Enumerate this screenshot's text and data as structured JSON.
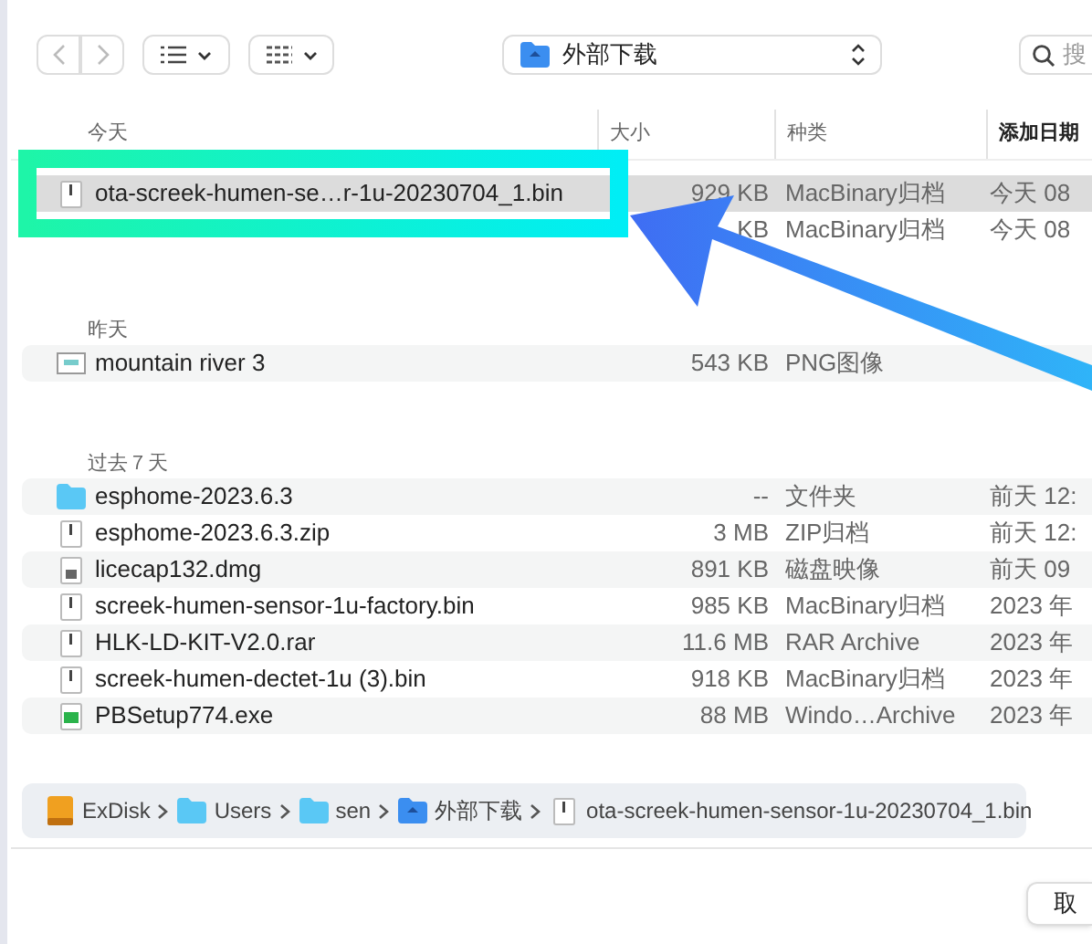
{
  "toolbar": {
    "location": "外部下载",
    "search_placeholder": "搜"
  },
  "columns": [
    {
      "label": "今天",
      "bold": false
    },
    {
      "label": "大小",
      "bold": false
    },
    {
      "label": "种类",
      "bold": false
    },
    {
      "label": "添加日期",
      "bold": true
    }
  ],
  "groups": [
    {
      "rows": [
        {
          "kind": "binary",
          "name": "ota-screek-humen-se…r-1u-20230704_1.bin",
          "size": "929 KB",
          "type": "MacBinary归档",
          "date": "今天 08",
          "selected": true
        },
        {
          "size": "KB",
          "type": "MacBinary归档",
          "date": "今天 08",
          "selected": false
        }
      ]
    },
    {
      "title": "昨天",
      "rows": [
        {
          "kind": "image",
          "name": "mountain river 3",
          "size": "543 KB",
          "type": "PNG图像",
          "selected": false
        }
      ]
    },
    {
      "title": "过去７天",
      "rows": [
        {
          "kind": "folder",
          "name": "esphome-2023.6.3",
          "size": "--",
          "type": "文件夹",
          "date": "前天 12:",
          "selected": false
        },
        {
          "kind": "binary",
          "name": "esphome-2023.6.3.zip",
          "size": "3 MB",
          "type": "ZIP归档",
          "date": "前天 12:",
          "selected": false
        },
        {
          "kind": "disk",
          "name": "licecap132.dmg",
          "size": "891 KB",
          "type": "磁盘映像",
          "date": "前天 09",
          "selected": false
        },
        {
          "kind": "binary",
          "name": "screek-humen-sensor-1u-factory.bin",
          "size": "985 KB",
          "type": "MacBinary归档",
          "date": "2023 年",
          "selected": false
        },
        {
          "kind": "binary",
          "name": "HLK-LD-KIT-V2.0.rar",
          "size": "11.6 MB",
          "type": "RAR Archive",
          "date": "2023 年",
          "selected": false
        },
        {
          "kind": "binary",
          "name": "screek-humen-dectet-1u (3).bin",
          "size": "918 KB",
          "type": "MacBinary归档",
          "date": "2023 年",
          "selected": false
        },
        {
          "kind": "exe",
          "name": "PBSetup774.exe",
          "size": "88 MB",
          "type": "Windo…Archive",
          "date": "2023 年",
          "selected": false
        }
      ]
    }
  ],
  "path": [
    {
      "kind": "drive",
      "label": "ExDisk"
    },
    {
      "kind": "folder",
      "label": "Users"
    },
    {
      "kind": "folder",
      "label": "sen"
    },
    {
      "kind": "download",
      "label": "外部下载"
    },
    {
      "kind": "binary",
      "label": "ota-screek-humen-sensor-1u-20230704_1.bin"
    }
  ],
  "cancel_button": "取"
}
